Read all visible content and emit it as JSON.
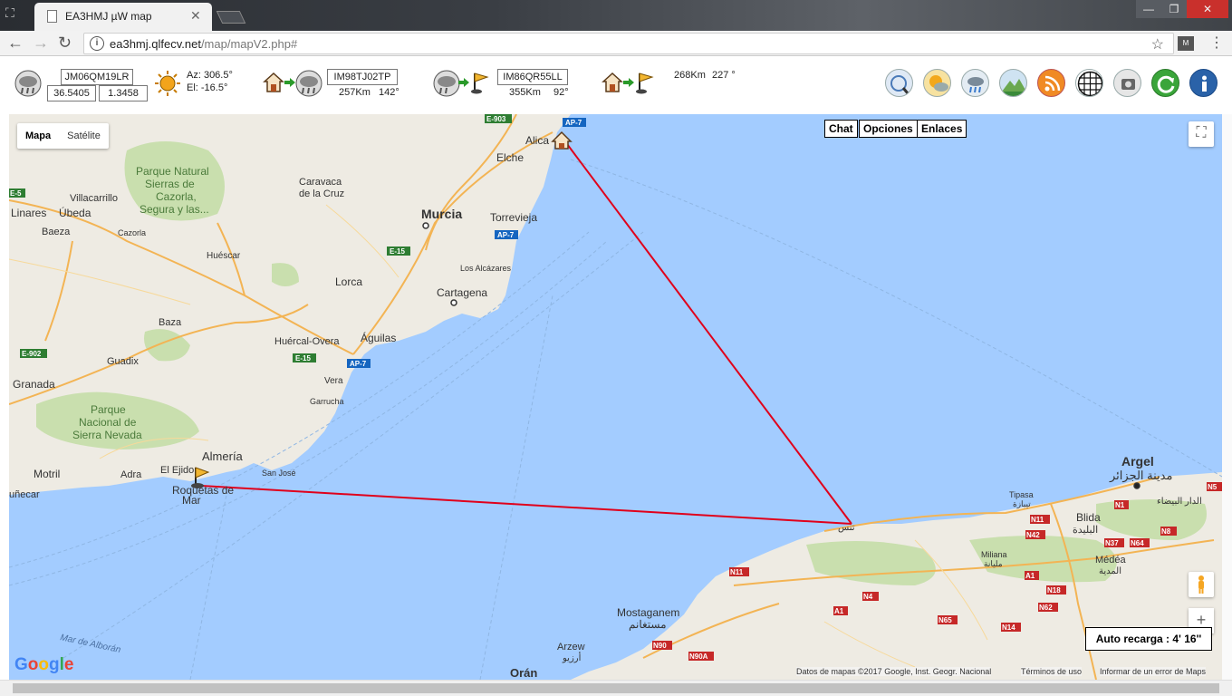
{
  "browser": {
    "tab_title": "EA3HMJ µW map",
    "url_host": "ea3hmj.qlfecv.net",
    "url_path": "/map/mapV2.php#",
    "ext_label": "M"
  },
  "info": {
    "locator1": "JM06QM19LR",
    "lat": "36.5405",
    "lon": "1.3458",
    "az": "Az: 306.5°",
    "el": "El:  -16.5°",
    "locator2": "IM98TJ02TP",
    "dist2": "257Km",
    "bearing2": "142°",
    "locator3": "IM86QR55LL",
    "dist3": "355Km",
    "bearing3": "92°",
    "dist4": "268Km",
    "bearing4": "227 °"
  },
  "map": {
    "type_map": "Mapa",
    "type_sat": "Satélite",
    "chat": "Chat",
    "options": "Opciones",
    "links": "Enlaces",
    "auto_reload": "Auto recarga : 4' 16''",
    "google": "Google",
    "attribution": "Datos de mapas ©2017 Google, Inst. Geogr. Nacional",
    "terms": "Términos de uso",
    "report": "Informar de un error de Maps",
    "zoom_in": "+"
  },
  "labels": {
    "alicante": "Alica",
    "elche": "Elche",
    "murcia": "Murcia",
    "torrevieja": "Torrevieja",
    "caravaca": "Caravaca",
    "delacruz": "de la Cruz",
    "villacarrillo": "Villacarrillo",
    "linares": "Linares",
    "ubeda": "Úbeda",
    "baeza": "Baeza",
    "cazorla": "Cazorla",
    "huescar": "Huéscar",
    "lorca": "Lorca",
    "cartagena": "Cartagena",
    "losalcazares": "Los Alcázares",
    "baza": "Baza",
    "huercal": "Huércal-Overa",
    "aguilas": "Águilas",
    "guadix": "Guadix",
    "granada": "Granada",
    "vera": "Vera",
    "garrucha": "Garrucha",
    "pn1a": "Parque Natural",
    "pn1b": "Sierras de",
    "pn1c": "Cazorla,",
    "pn1d": "Segura y las...",
    "pn2a": "Parque",
    "pn2b": "Nacional de",
    "pn2c": "Sierra Nevada",
    "almeria": "Almería",
    "sanjose": "San José",
    "elejido": "El Ejido",
    "adra": "Adra",
    "motril": "Motril",
    "munecar": "uñecar",
    "roquetas1": "Roquetas de",
    "roquetas2": "Mar",
    "mardealboran": "Mar de Alborán",
    "argel": "Argel",
    "argel_ar": "مدينة الجزائر",
    "tipasa": "Tipasa",
    "tipasa_ar": "تيبازة",
    "blida": "Blida",
    "blida_ar": "البليدة",
    "medea": "Médéa",
    "medea_ar": "المدية",
    "miliana": "Miliana",
    "miliana_ar": "مليانة",
    "daralbeida": "الدار البيضاء",
    "mostaganem": "Mostaganem",
    "mostaganem_ar": "مستغانم",
    "arzew": "Arzew",
    "arzew_ar": "أرزيو",
    "oran": "Orán",
    "tenes": "تنس",
    "e903": "E-903",
    "ap7a": "AP-7",
    "ap7b": "AP-7",
    "ap7c": "AP-7",
    "e15a": "E-15",
    "e15b": "E-15",
    "e902": "E-902",
    "e5": "E-5",
    "n1": "N1",
    "n11a": "N11",
    "n11b": "N11",
    "n42": "N42",
    "n37": "N37",
    "n64": "N64",
    "n8": "N8",
    "n4": "N4",
    "n65": "N65",
    "n14": "N14",
    "n18": "N18",
    "n62": "N62",
    "a1": "A1",
    "a1b": "A1",
    "n90": "N90",
    "n90a": "N90A",
    "n5": "N5"
  },
  "icon_names": [
    "cloud-icon",
    "sun-icon",
    "home-icon",
    "arrow-icon",
    "flag-icon",
    "radar-icon",
    "weather-icon",
    "rain-icon",
    "terrain-icon",
    "rss-icon",
    "grid-icon",
    "camera-icon",
    "refresh-icon",
    "info-icon"
  ]
}
